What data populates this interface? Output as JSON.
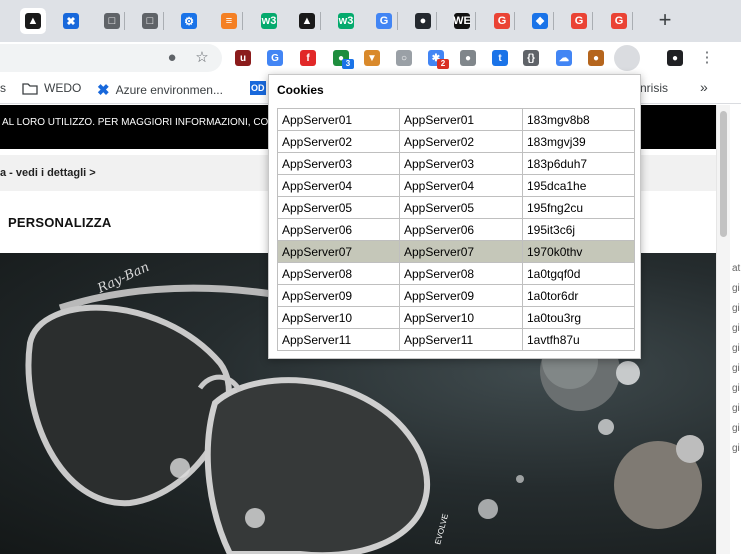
{
  "tabs": [
    {
      "icon": "bird-icon",
      "color": "#1a1a1a",
      "glyph": "▲"
    },
    {
      "icon": "confluence-icon",
      "color": "#1868db",
      "glyph": "✖"
    },
    {
      "icon": "document-icon",
      "color": "#5f6368",
      "glyph": "□"
    },
    {
      "icon": "document-icon",
      "color": "#5f6368",
      "glyph": "□"
    },
    {
      "icon": "gear-icon",
      "color": "#1a73e8",
      "glyph": "⚙"
    },
    {
      "icon": "stack-overflow-icon",
      "color": "#f48024",
      "glyph": "≡"
    },
    {
      "icon": "w3schools-icon",
      "color": "#04aa6d",
      "glyph": "w3"
    },
    {
      "icon": "bird-icon",
      "color": "#1a1a1a",
      "glyph": "▲"
    },
    {
      "icon": "w3schools-icon",
      "color": "#04aa6d",
      "glyph": "w3"
    },
    {
      "icon": "google-translate-icon",
      "color": "#4285f4",
      "glyph": "G"
    },
    {
      "icon": "github-icon",
      "color": "#24292f",
      "glyph": "●"
    },
    {
      "icon": "wedo-icon",
      "color": "#111111",
      "glyph": "WE"
    },
    {
      "icon": "google-icon",
      "color": "#ea4335",
      "glyph": "G"
    },
    {
      "icon": "puzzle-icon",
      "color": "#1a73e8",
      "glyph": "❖"
    },
    {
      "icon": "google-icon",
      "color": "#ea4335",
      "glyph": "G"
    },
    {
      "icon": "google-icon",
      "color": "#ea4335",
      "glyph": "G"
    }
  ],
  "new_tab_label": "+",
  "extensions": [
    {
      "icon": "ublock-icon",
      "color": "#8b1c1c",
      "glyph": "u"
    },
    {
      "icon": "google-translate-icon",
      "color": "#4285f4",
      "glyph": "G"
    },
    {
      "icon": "flipboard-icon",
      "color": "#e12828",
      "glyph": "f"
    },
    {
      "icon": "green-circle-icon",
      "color": "#1e8e3e",
      "glyph": "●",
      "badge": "3",
      "badge_color": "#1a73e8"
    },
    {
      "icon": "basket-icon",
      "color": "#d9892b",
      "glyph": "▼"
    },
    {
      "icon": "clock-icon",
      "color": "#9aa0a6",
      "glyph": "○"
    },
    {
      "icon": "octopus-icon",
      "color": "#4285f4",
      "glyph": "✱",
      "badge": "2",
      "badge_color": "#d93025"
    },
    {
      "icon": "circle-grey-icon",
      "color": "#80868b",
      "glyph": "●"
    },
    {
      "icon": "t-icon",
      "color": "#1a73e8",
      "glyph": "t"
    },
    {
      "icon": "json-icon",
      "color": "#5f6368",
      "glyph": "{}"
    },
    {
      "icon": "cloud-icon",
      "color": "#4285f4",
      "glyph": "☁"
    },
    {
      "icon": "cookie-icon",
      "color": "#b5651d",
      "glyph": "●"
    },
    {
      "icon": "server-cookie-icon",
      "color": "#3c4043",
      "glyph": "☰"
    },
    {
      "icon": "avatar-icon",
      "color": "#202124",
      "glyph": "●"
    }
  ],
  "bookmarks": {
    "item_s": "s",
    "wedo": "WEDO",
    "azure": "Azure environmen...",
    "od": "OD",
    "risis": "nrisis",
    "more": "»"
  },
  "page": {
    "banner_text": "AL LORO UTILIZZO. PER MAGGIORI INFORMAZIONI, CO",
    "promo_text": "a - vedi i dettagli >",
    "nav_item": "PERSONALIZZA",
    "hero_brand": "Ray-Ban",
    "hero_side_text": "EVOLVE"
  },
  "side_panel_lines": [
    "at",
    "gi",
    "gi",
    "gi",
    "gi",
    "gi",
    "gi",
    "gi",
    "gi",
    "gi"
  ],
  "popup": {
    "title": "Cookies",
    "selected_index": 6,
    "rows": [
      [
        "AppServer01",
        "AppServer01",
        "183mgv8b8"
      ],
      [
        "AppServer02",
        "AppServer02",
        "183mgvj39"
      ],
      [
        "AppServer03",
        "AppServer03",
        "183p6duh7"
      ],
      [
        "AppServer04",
        "AppServer04",
        "195dca1he"
      ],
      [
        "AppServer05",
        "AppServer05",
        "195fng2cu"
      ],
      [
        "AppServer06",
        "AppServer06",
        "195it3c6j"
      ],
      [
        "AppServer07",
        "AppServer07",
        "1970k0thv"
      ],
      [
        "AppServer08",
        "AppServer08",
        "1a0tgqf0d"
      ],
      [
        "AppServer09",
        "AppServer09",
        "1a0tor6dr"
      ],
      [
        "AppServer10",
        "AppServer10",
        "1a0tou3rg"
      ],
      [
        "AppServer11",
        "AppServer11",
        "1avtfh87u"
      ]
    ]
  }
}
